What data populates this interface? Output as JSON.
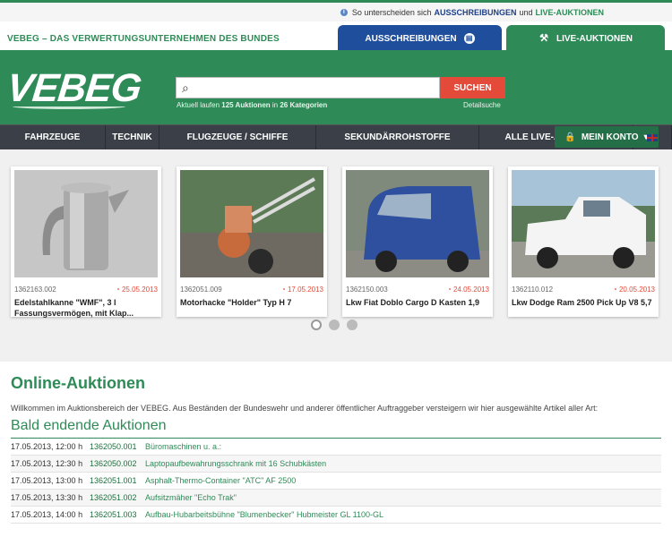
{
  "topbar": {
    "prefix": "So unterscheiden sich",
    "link1": "AUSSCHREIBUNGEN",
    "and": "und",
    "link2": "LIVE-AUKTIONEN"
  },
  "brand": {
    "tagline": "VEBEG – DAS VERWERTUNGSUNTERNEHMEN DES BUNDES",
    "logo": "VEBEG"
  },
  "tabs": [
    {
      "label": "AUSSCHREIBUNGEN"
    },
    {
      "label": "LIVE-AUKTIONEN"
    }
  ],
  "search": {
    "placeholder": "",
    "button": "SUCHEN",
    "detail": "Detailsuche",
    "stats_prefix": "Aktuell laufen",
    "stats_count": "125 Auktionen",
    "stats_mid": "in",
    "stats_cat": "26 Kategorien"
  },
  "account": {
    "label": "MEIN KONTO"
  },
  "nav": [
    "FAHRZEUGE",
    "TECHNIK",
    "FLUGZEUGE / SCHIFFE",
    "SEKUNDÄRROHSTOFFE",
    "ALLE LIVE-AUKTIONEN"
  ],
  "cards": [
    {
      "id": "1362163.002",
      "date": "25.05.2013",
      "title": "Edelstahlkanne \"WMF\", 3 l Fassungsvermögen, mit Klap..."
    },
    {
      "id": "1362051.009",
      "date": "17.05.2013",
      "title": "Motorhacke \"Holder\" Typ H 7"
    },
    {
      "id": "1362150.003",
      "date": "24.05.2013",
      "title": "Lkw Fiat Doblo Cargo D Kasten 1,9"
    },
    {
      "id": "1362110.012",
      "date": "20.05.2013",
      "title": "Lkw Dodge Ram 2500 Pick Up V8 5,7"
    }
  ],
  "main": {
    "title": "Online-Auktionen",
    "intro": "Willkommen im Auktionsbereich der VEBEG. Aus Beständen der Bundeswehr und anderer öffentlicher Auftraggeber versteigern wir hier ausgewählte Artikel aller Art:",
    "subtitle": "Bald endende Auktionen",
    "rows": [
      {
        "time": "17.05.2013, 12:00 h",
        "id": "1362050.001",
        "desc": "Büromaschinen u. a.:"
      },
      {
        "time": "17.05.2013, 12:30 h",
        "id": "1362050.002",
        "desc": "Laptopaufbewahrungsschrank mit 16 Schubkästen"
      },
      {
        "time": "17.05.2013, 13:00 h",
        "id": "1362051.001",
        "desc": "Asphalt-Thermo-Container \"ATC\" AF 2500"
      },
      {
        "time": "17.05.2013, 13:30 h",
        "id": "1362051.002",
        "desc": "Aufsitzmäher \"Echo Trak\""
      },
      {
        "time": "17.05.2013, 14:00 h",
        "id": "1362051.003",
        "desc": "Aufbau-Hubarbeitsbühne \"Blumenbecker\" Hubmeister GL 1100-GL"
      }
    ]
  },
  "icons": {
    "info": "info-icon",
    "search": "search-icon",
    "lock": "lock-icon",
    "gavel": "gavel-icon",
    "clock": "clock-icon"
  }
}
